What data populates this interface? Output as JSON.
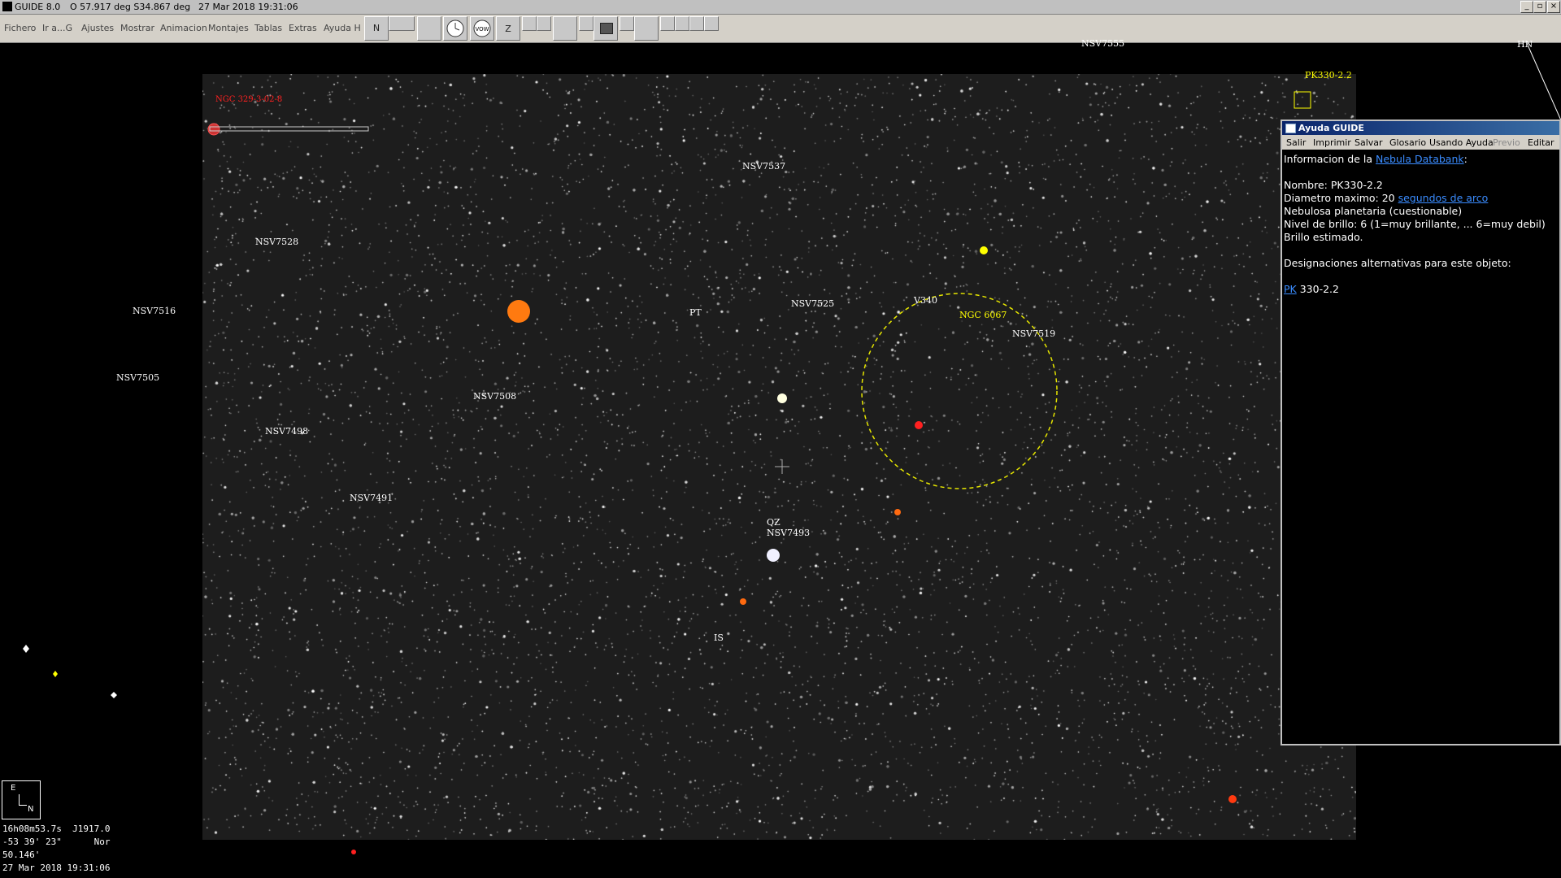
{
  "titlebar": {
    "app": "GUIDE 8.0",
    "coords": "O 57.917 deg S34.867 deg",
    "datetime": "27 Mar 2018 19:31:06"
  },
  "menu": [
    "Fichero",
    "Ir a...G",
    "Ajustes",
    "Mostrar",
    "Animacion",
    "Montajes",
    "Tablas",
    "Extras",
    "Ayuda H"
  ],
  "toolbar": {
    "north": "N",
    "zoom": "Z",
    "vow": "VOW"
  },
  "labels": {
    "nsv7555": "NSV7555",
    "pk_top": "PK330-2.2",
    "hn": "HN",
    "ngc_red": "NGC 329-3-02-8",
    "nsv7537": "NSV7537",
    "nsv7528": "NSV7528",
    "nsv7516": "NSV7516",
    "nsv7505": "NSV7505",
    "pt": "PT",
    "nsv7525": "NSV7525",
    "v340": "V340",
    "ngc6067": "NGC 6067",
    "nsv7519": "NSV7519",
    "nsv7508": "NSV7508",
    "nsv7498": "NSV7498",
    "nsv7491": "NSV7491",
    "qz": "QZ",
    "nsv7493": "NSV7493",
    "is": "IS"
  },
  "compass": {
    "east": "E",
    "north": "N"
  },
  "status": {
    "ra": "16h08m53.7s  J1917.0",
    "dec": "-53 39' 23\"      Nor",
    "fov": "50.146'",
    "datetime": "27 Mar 2018 19:31:06"
  },
  "help": {
    "title": "Ayuda GUIDE",
    "menu": [
      "Salir",
      "Imprimir",
      "Salvar",
      "Glosario",
      "Usando Ayuda",
      "Previo",
      "Editar"
    ],
    "intro_prefix": "Informacion de la ",
    "intro_link": "Nebula Databank",
    "intro_suffix": ":",
    "name": "Nombre: PK330-2.2",
    "diam_prefix": "Diametro maximo: 20 ",
    "diam_link": "segundos de arco",
    "type": "Nebulosa planetaria (cuestionable)",
    "brightness": "Nivel de brillo: 6 (1=muy brillante, ... 6=muy debil)",
    "estimated": "Brillo estimado.",
    "alt_heading": "Designaciones alternativas para este objeto:",
    "alt_link": "PK",
    "alt_value": " 330-2.2"
  },
  "colors": {
    "yellow_label": "#ffff00",
    "red_label": "#ff2020",
    "link": "#3a8cff",
    "cluster_circle": "#e6e600",
    "orange_star": "#ff7a10"
  }
}
